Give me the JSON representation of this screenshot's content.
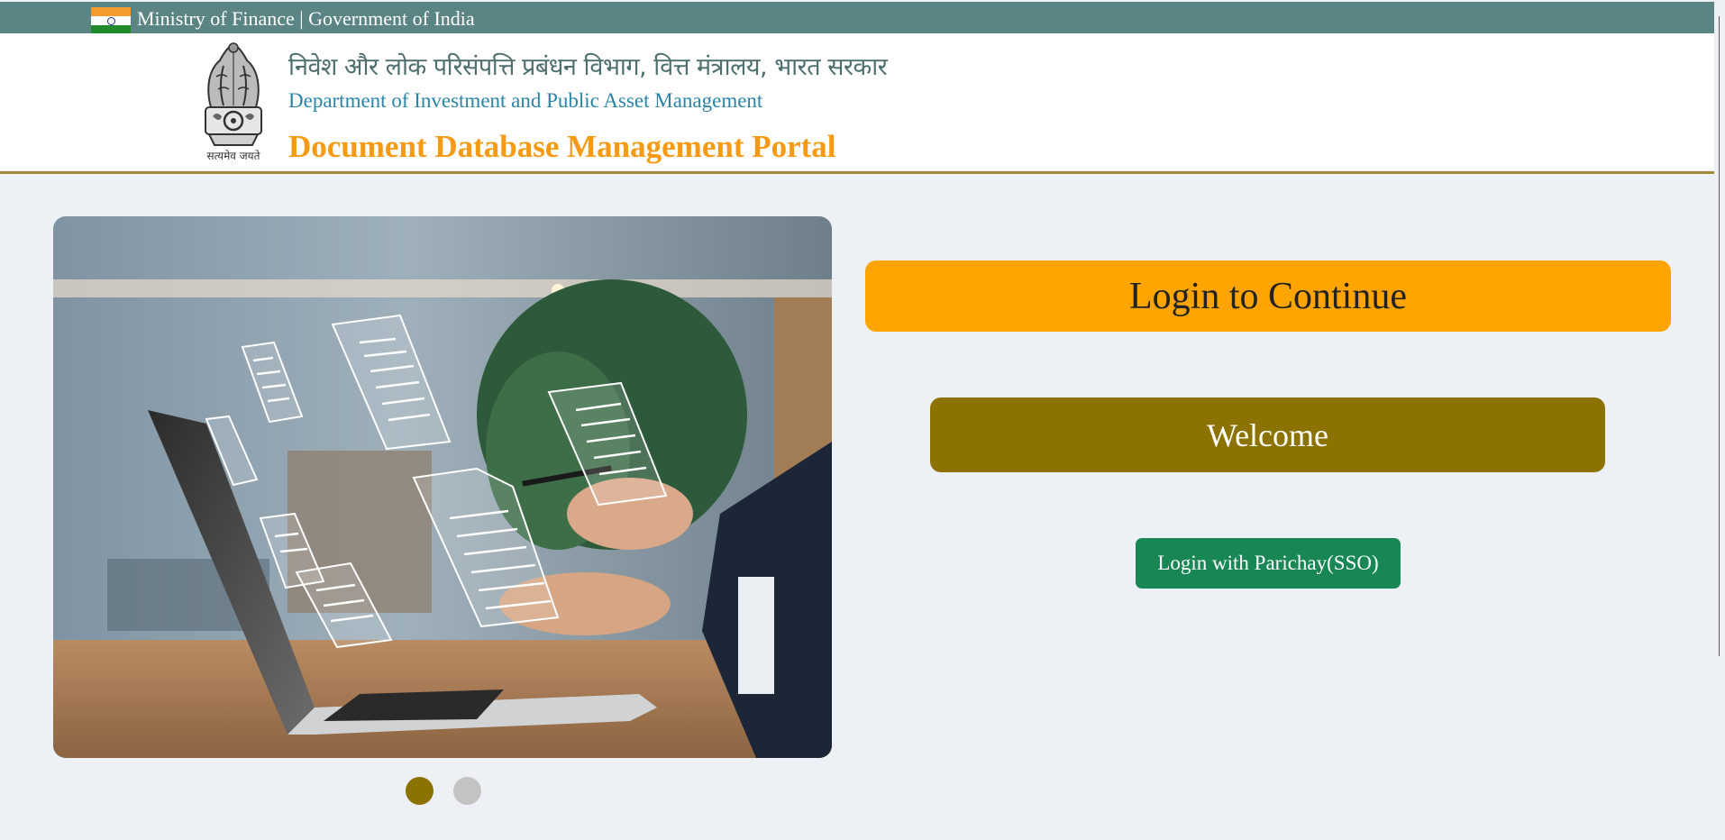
{
  "topbar": {
    "ministry_text": "Ministry of Finance | Government of India"
  },
  "header": {
    "hindi_title": "निवेश और लोक परिसंपत्ति प्रबंधन विभाग, वित्त मंत्रालय, भारत सरकार",
    "department": "Department of Investment and Public Asset Management",
    "portal_title": "Document Database Management Portal",
    "emblem_motto": "सत्यमेव जयते"
  },
  "main": {
    "login_banner": "Login to Continue",
    "welcome": "Welcome",
    "sso_button": "Login with Parichay(SSO)"
  },
  "carousel": {
    "active_slide": 1,
    "slide_count": 2
  },
  "colors": {
    "topbar": "#5b8585",
    "accent_orange": "#ffa400",
    "accent_olive": "#8c7300",
    "sso_green": "#198754",
    "portal_title": "#f59a12",
    "background": "#edf1f6"
  }
}
